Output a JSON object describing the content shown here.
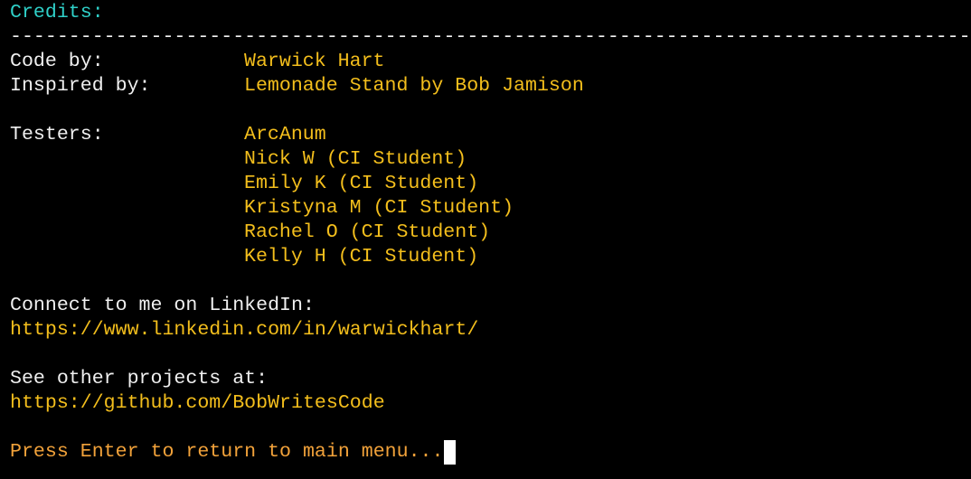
{
  "title": "Credits:",
  "separator": "--------------------------------------------------------------------------------------",
  "rows": {
    "code_label": "Code by:",
    "code_value": "Warwick Hart",
    "inspired_label": "Inspired by:",
    "inspired_value": "Lemonade Stand by Bob Jamison",
    "testers_label": "Testers:"
  },
  "testers": [
    "ArcAnum",
    "Nick W (CI Student)",
    "Emily K (CI Student)",
    "Kristyna M (CI Student)",
    "Rachel O (CI Student)",
    "Kelly H (CI Student)"
  ],
  "linkedin": {
    "label": "Connect to me on LinkedIn:",
    "url": "https://www.linkedin.com/in/warwickhart/"
  },
  "github": {
    "label": "See other projects at:",
    "url": "https://github.com/BobWritesCode"
  },
  "prompt": "Press Enter to return to main menu...",
  "colors": {
    "background": "#000000",
    "title": "#2fd0c8",
    "label": "#f0f0f0",
    "value": "#f3be1c",
    "prompt": "#f2a23a"
  }
}
